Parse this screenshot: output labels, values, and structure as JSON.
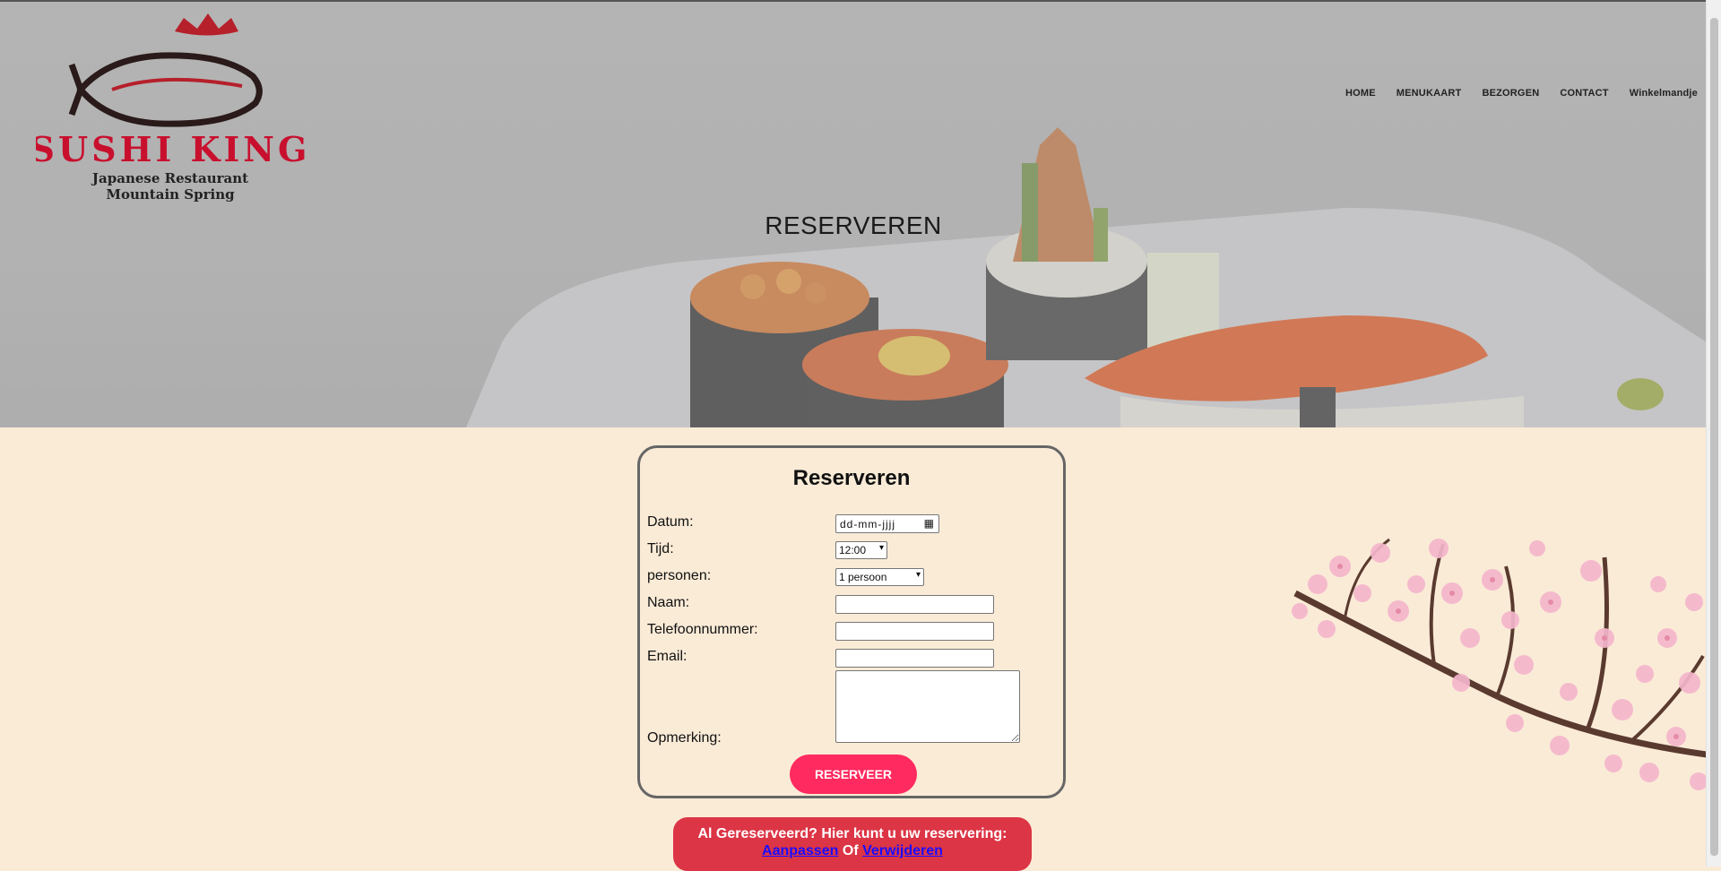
{
  "logo": {
    "brand": "SUSHI KING",
    "line1": "Japanese Restaurant",
    "line2": "Mountain Spring"
  },
  "nav": {
    "items": [
      "HOME",
      "MENUKAART",
      "BEZORGEN",
      "CONTACT",
      "Winkelmandje"
    ]
  },
  "hero": {
    "title": "RESERVEREN"
  },
  "form": {
    "title": "Reserveren",
    "labels": {
      "datum": "Datum:",
      "tijd": "Tijd:",
      "personen": "personen:",
      "naam": "Naam:",
      "telefoon": "Telefoonnummer:",
      "email": "Email:",
      "opmerking": "Opmerking:"
    },
    "datum_placeholder": "dd-mm-jjjj",
    "tijd_value": "12:00",
    "personen_value": "1 persoon",
    "submit": "RESERVEER"
  },
  "already": {
    "text": "Al Gereserveerd? Hier kunt u uw reservering:",
    "link_edit": "Aanpassen",
    "or": "Of",
    "link_delete": "Verwijderen"
  },
  "colors": {
    "background": "#faebd7",
    "button": "#ff2a5f",
    "banner": "#dc3545",
    "brand_red": "#c8102e"
  }
}
